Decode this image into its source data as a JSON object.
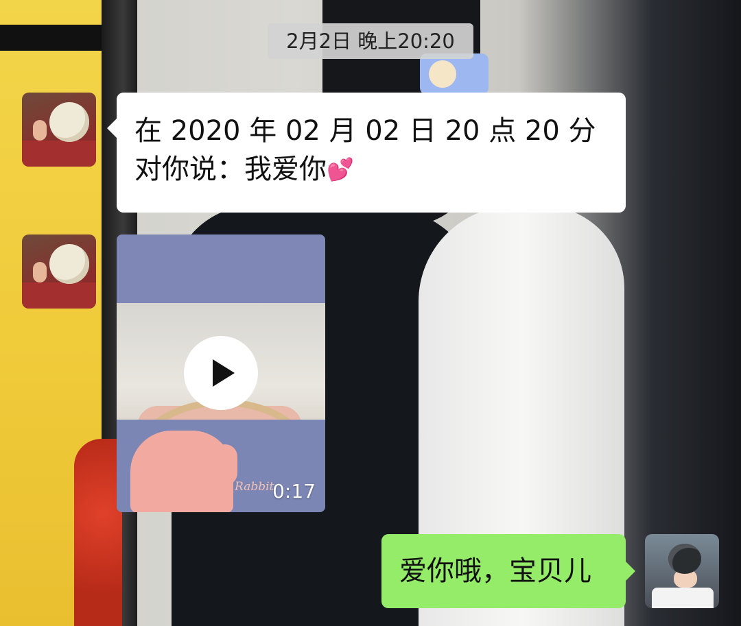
{
  "chat": {
    "timestamp": "2月2日 晚上20:20",
    "messages": [
      {
        "side": "left",
        "type": "text",
        "line1": "在 2020 年 02 月 02 日 20 点 20 分",
        "line2": "对你说：我爱你",
        "emoji": "heart-icon"
      },
      {
        "side": "left",
        "type": "video",
        "duration": "0:17",
        "thumbnail_caption": "Rabbit"
      },
      {
        "side": "right",
        "type": "text",
        "text": "爱你哦，宝贝儿"
      }
    ]
  },
  "colors": {
    "bubble_incoming": "#ffffff",
    "bubble_outgoing": "#95ec69",
    "emoji_heart": "#ff5ea8"
  }
}
